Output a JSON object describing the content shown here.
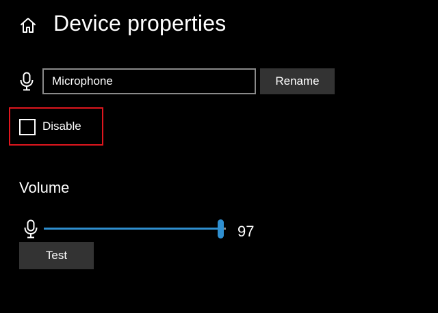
{
  "header": {
    "title": "Device properties",
    "home_icon": "home-icon"
  },
  "device_name": {
    "icon": "microphone-icon",
    "value": "Microphone",
    "rename_label": "Rename"
  },
  "disable": {
    "label": "Disable",
    "checked": false
  },
  "volume": {
    "heading": "Volume",
    "icon": "microphone-icon",
    "value": 97,
    "value_text": "97",
    "max": 100,
    "test_label": "Test"
  },
  "colors": {
    "accent": "#2f8fd0",
    "highlight": "#e0161e",
    "button_bg": "#333333",
    "background": "#000000"
  }
}
